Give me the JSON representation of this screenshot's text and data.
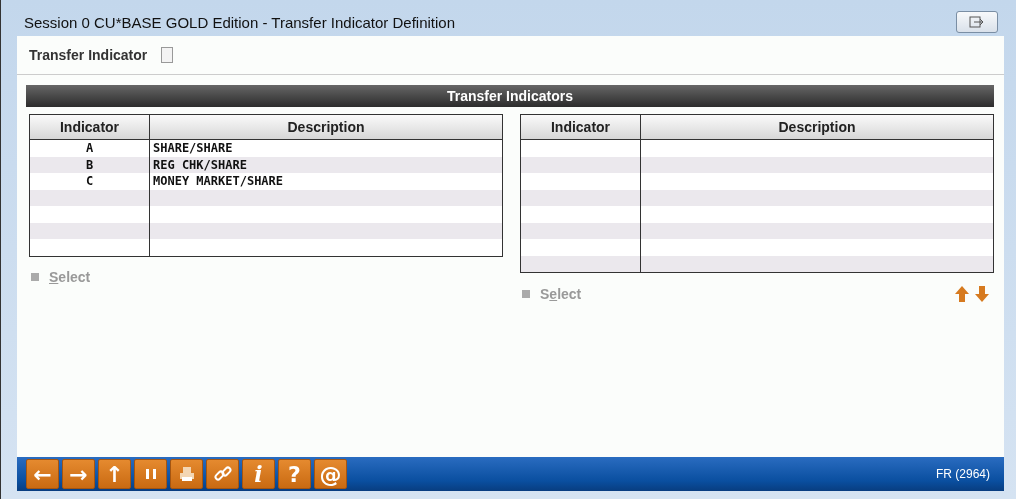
{
  "window": {
    "title": "Session 0 CU*BASE GOLD Edition - Transfer Indicator Definition"
  },
  "filter": {
    "label": "Transfer Indicator"
  },
  "section_title": "Transfer Indicators",
  "tables": [
    {
      "columns": [
        "Indicator",
        "Description"
      ],
      "rows": [
        [
          "A",
          "SHARE/SHARE"
        ],
        [
          "B",
          "REG CHK/SHARE"
        ],
        [
          "C",
          "MONEY MARKET/SHARE"
        ],
        [
          "",
          ""
        ],
        [
          "",
          ""
        ],
        [
          "",
          ""
        ],
        [
          "",
          ""
        ]
      ],
      "action": {
        "underlined": "S",
        "after": "elect"
      }
    },
    {
      "columns": [
        "Indicator",
        "Description"
      ],
      "rows": [
        [
          "",
          ""
        ],
        [
          "",
          ""
        ],
        [
          "",
          ""
        ],
        [
          "",
          ""
        ],
        [
          "",
          ""
        ],
        [
          "",
          ""
        ],
        [
          "",
          ""
        ],
        [
          "",
          ""
        ]
      ],
      "action": {
        "before": "S",
        "underlined": "e",
        "after": "lect"
      }
    }
  ],
  "toolbar": [
    {
      "kind": "char",
      "label": "←"
    },
    {
      "kind": "char",
      "label": "→"
    },
    {
      "kind": "char",
      "label": "↑"
    },
    {
      "kind": "pause"
    },
    {
      "kind": "printer"
    },
    {
      "kind": "link"
    },
    {
      "kind": "italic",
      "label": "i"
    },
    {
      "kind": "char",
      "label": "?"
    },
    {
      "kind": "char",
      "label": "@"
    }
  ],
  "status": "FR (2964)"
}
